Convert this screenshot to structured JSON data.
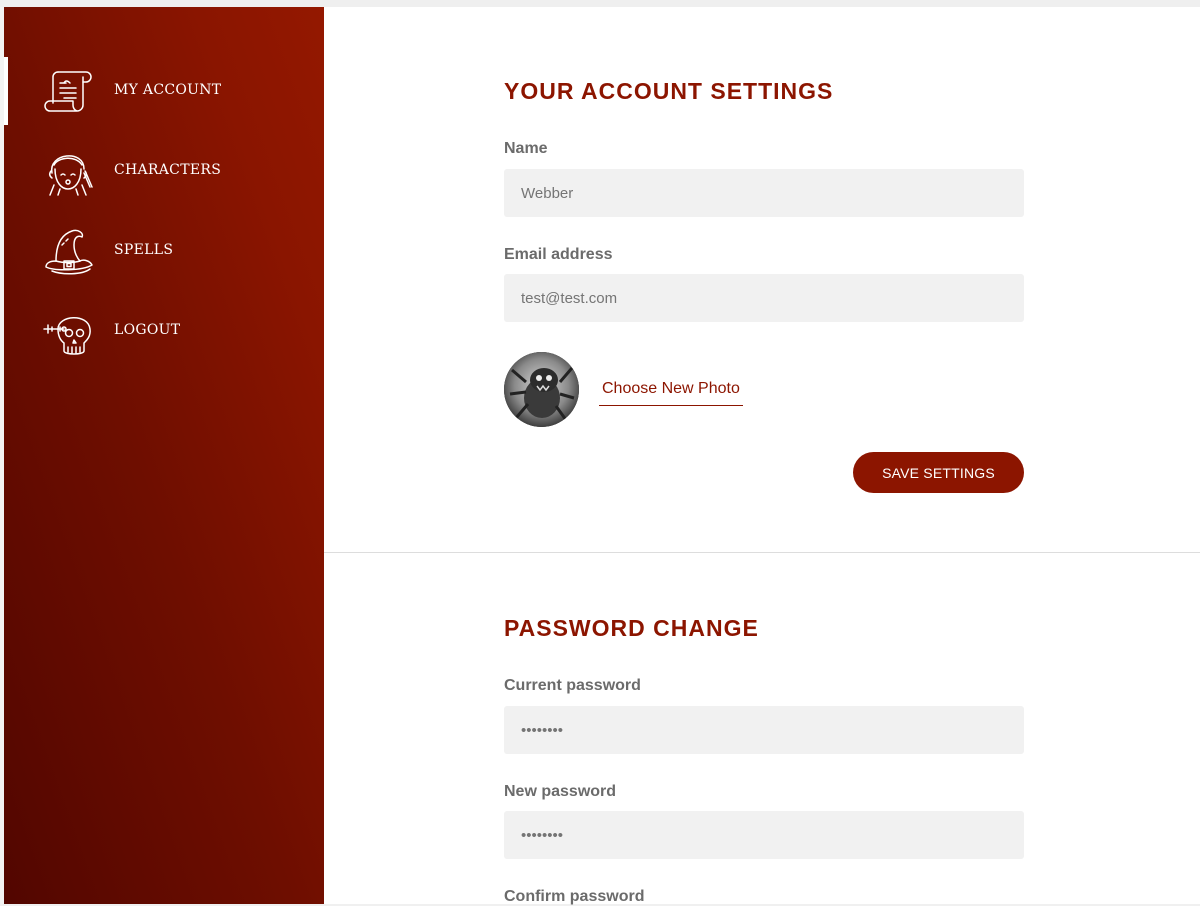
{
  "sidebar": {
    "items": [
      {
        "label": "MY ACCOUNT",
        "icon": "scroll-icon",
        "active": true
      },
      {
        "label": "CHARACTERS",
        "icon": "character-icon",
        "active": false
      },
      {
        "label": "SPELLS",
        "icon": "wizard-hat-icon",
        "active": false
      },
      {
        "label": "LOGOUT",
        "icon": "skull-key-icon",
        "active": false
      }
    ]
  },
  "account": {
    "title": "YOUR ACCOUNT SETTINGS",
    "name_label": "Name",
    "name_placeholder": "Webber",
    "email_label": "Email address",
    "email_placeholder": "test@test.com",
    "choose_photo": "Choose New Photo",
    "save_button": "SAVE SETTINGS"
  },
  "password": {
    "title": "PASSWORD CHANGE",
    "current_label": "Current password",
    "current_placeholder": "••••••••",
    "new_label": "New password",
    "new_placeholder": "••••••••",
    "confirm_label": "Confirm password"
  },
  "colors": {
    "accent": "#8c1500",
    "sidebar_dark": "#520600",
    "sidebar_light": "#941800",
    "input_bg": "#f1f1f1"
  }
}
